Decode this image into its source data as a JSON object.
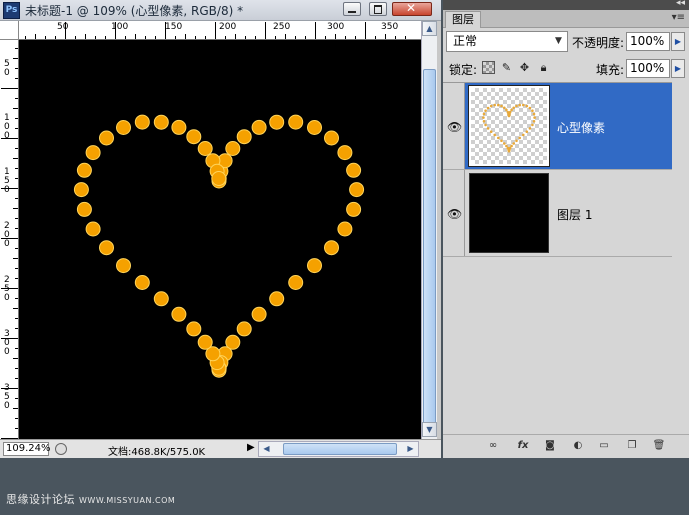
{
  "document": {
    "title": "未标题-1 @ 109% (心型像素, RGB/8) *",
    "app_icon": "Ps",
    "ruler_top_labels": [
      "50",
      "100",
      "150",
      "200",
      "250",
      "300",
      "350"
    ],
    "ruler_left_labels": [
      "5\n0",
      "1\n0\n0",
      "1\n5\n0",
      "2\n0\n0",
      "2\n5\n0",
      "3\n0\n0",
      "3\n5\n0"
    ],
    "canvas_background": "#000000",
    "dot_color": "#f5a100"
  },
  "statusbar": {
    "zoom": "109.24%",
    "doc_info": "文档:468.8K/575.0K"
  },
  "layers_panel": {
    "tab_label": "图层",
    "blend_mode": "正常",
    "opacity_label": "不透明度:",
    "opacity_value": "100%",
    "lock_label": "锁定:",
    "fill_label": "填充:",
    "fill_value": "100%",
    "layers": [
      {
        "name": "心型像素",
        "selected": true,
        "visible": true
      },
      {
        "name": "图层 1",
        "selected": false,
        "visible": true
      }
    ],
    "footer_icons": [
      "link-layers-icon",
      "fx-icon",
      "mask-icon",
      "adjustment-layer-icon",
      "new-group-icon",
      "new-layer-icon",
      "trash-icon"
    ]
  },
  "watermark": {
    "text_main": "思缘设计论坛",
    "text_url": "WWW.MISSYUAN.COM"
  },
  "colors": {
    "selection_blue": "#316ac5",
    "desktop": "#4a555e"
  }
}
